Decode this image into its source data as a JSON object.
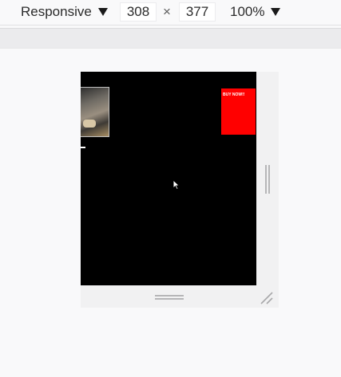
{
  "toolbar": {
    "device_label": "Responsive",
    "width_value": "308",
    "times_sign": "×",
    "height_value": "377",
    "zoom_label": "100%"
  },
  "viewport": {
    "buy_button_label": "BUY NOW!!",
    "buy_button_color": "#ff0000",
    "background_color": "#000000"
  },
  "icons": {
    "device_caret": "caret-down-icon",
    "zoom_caret": "caret-down-icon",
    "cursor": "mouse-pointer-icon",
    "corner": "resize-corner-icon"
  }
}
